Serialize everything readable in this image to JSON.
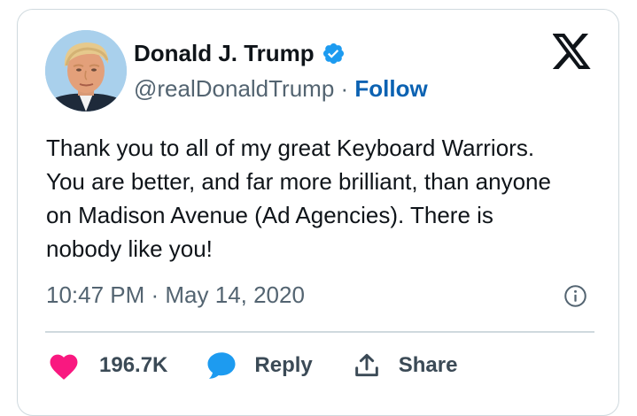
{
  "author": {
    "display_name": "Donald J. Trump",
    "handle": "@realDonaldTrump",
    "separator": "·",
    "follow_label": "Follow",
    "verified": true
  },
  "tweet": {
    "text_lines": [
      "Thank you to all of my great Keyboard Warriors.",
      "You are better, and far more brilliant, than anyone",
      "on Madison Avenue (Ad Agencies). There is",
      "nobody like you!"
    ],
    "timestamp": "10:47 PM · May 14, 2020"
  },
  "actions": {
    "like_count": "196.7K",
    "reply_label": "Reply",
    "share_label": "Share"
  },
  "icons": {
    "logo": "x-logo",
    "verified": "verified-badge-icon",
    "info": "info-icon",
    "like": "heart-icon",
    "reply": "speech-bubble-icon",
    "share": "share-upload-icon"
  },
  "colors": {
    "link_blue": "#0b62b2",
    "verified_blue": "#1d9bf0",
    "heart_pink": "#f91880",
    "reply_blue": "#1d9bf0",
    "muted_text": "#536471",
    "border": "#cfd9de"
  }
}
